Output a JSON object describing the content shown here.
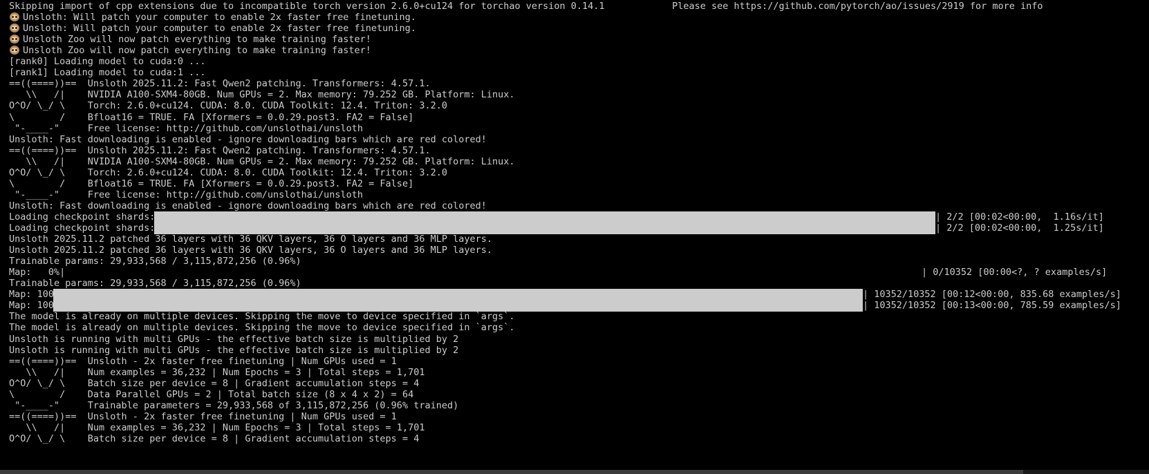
{
  "terminal": {
    "lines": [
      {
        "type": "text",
        "text": "Skipping import of cpp extensions due to incompatible torch version 2.6.0+cu124 for torchao version 0.14.1            Please see https://github.com/pytorch/ao/issues/2919 for more info"
      },
      {
        "type": "sloth",
        "text": "Unsloth: Will patch your computer to enable 2x faster free finetuning."
      },
      {
        "type": "sloth",
        "text": "Unsloth: Will patch your computer to enable 2x faster free finetuning."
      },
      {
        "type": "sloth",
        "text": "Unsloth Zoo will now patch everything to make training faster!"
      },
      {
        "type": "sloth",
        "text": "Unsloth Zoo will now patch everything to make training faster!"
      },
      {
        "type": "text",
        "text": "[rank0] Loading model to cuda:0 ..."
      },
      {
        "type": "text",
        "text": "[rank1] Loading model to cuda:1 ..."
      },
      {
        "type": "text",
        "text": "==((====))==  Unsloth 2025.11.2: Fast Qwen2 patching. Transformers: 4.57.1."
      },
      {
        "type": "text",
        "text": "   \\\\   /|    NVIDIA A100-SXM4-80GB. Num GPUs = 2. Max memory: 79.252 GB. Platform: Linux."
      },
      {
        "type": "text",
        "text": "O^O/ \\_/ \\    Torch: 2.6.0+cu124. CUDA: 8.0. CUDA Toolkit: 12.4. Triton: 3.2.0"
      },
      {
        "type": "text",
        "text": "\\        /    Bfloat16 = TRUE. FA [Xformers = 0.0.29.post3. FA2 = False]"
      },
      {
        "type": "text",
        "text": " \"-____-\"     Free license: http://github.com/unslothai/unsloth"
      },
      {
        "type": "text",
        "text": "Unsloth: Fast downloading is enabled - ignore downloading bars which are red colored!"
      },
      {
        "type": "text",
        "text": "==((====))==  Unsloth 2025.11.2: Fast Qwen2 patching. Transformers: 4.57.1."
      },
      {
        "type": "text",
        "text": "   \\\\   /|    NVIDIA A100-SXM4-80GB. Num GPUs = 2. Max memory: 79.252 GB. Platform: Linux."
      },
      {
        "type": "text",
        "text": "O^O/ \\_/ \\    Torch: 2.6.0+cu124. CUDA: 8.0. CUDA Toolkit: 12.4. Triton: 3.2.0"
      },
      {
        "type": "text",
        "text": "\\        /    Bfloat16 = TRUE. FA [Xformers = 0.0.29.post3. FA2 = False]"
      },
      {
        "type": "text",
        "text": " \"-____-\"     Free license: http://github.com/unslothai/unsloth"
      },
      {
        "type": "text",
        "text": "Unsloth: Fast downloading is enabled - ignore downloading bars which are red colored!"
      },
      {
        "type": "progress",
        "label": "Loading checkpoint shards: 100%|",
        "progress": 1.0,
        "suffix": "| 2/2 [00:02<00:00,  1.16s/it]",
        "bar": "shards"
      },
      {
        "type": "progress",
        "label": "Loading checkpoint shards: 100%|",
        "progress": 1.0,
        "suffix": "| 2/2 [00:02<00:00,  1.25s/it]",
        "bar": "shards"
      },
      {
        "type": "text",
        "text": "Unsloth 2025.11.2 patched 36 layers with 36 QKV layers, 36 O layers and 36 MLP layers."
      },
      {
        "type": "text",
        "text": "Unsloth 2025.11.2 patched 36 layers with 36 QKV layers, 36 O layers and 36 MLP layers."
      },
      {
        "type": "text",
        "text": "Trainable params: 29,933,568 / 3,115,872,256 (0.96%)"
      },
      {
        "type": "progress",
        "label": "Map:   0%|",
        "progress": 0.0,
        "suffix": "| 0/10352 [00:00<?, ? examples/s]",
        "bar": "map0"
      },
      {
        "type": "text",
        "text": "Trainable params: 29,933,568 / 3,115,872,256 (0.96%)"
      },
      {
        "type": "progress",
        "label": "Map: 100%|",
        "progress": 1.0,
        "suffix": "| 10352/10352 [00:12<00:00, 835.68 examples/s]",
        "bar": "map"
      },
      {
        "type": "progress",
        "label": "Map: 100%|",
        "progress": 1.0,
        "suffix": "| 10352/10352 [00:13<00:00, 785.59 examples/s]",
        "bar": "map"
      },
      {
        "type": "text",
        "text": "The model is already on multiple devices. Skipping the move to device specified in `args`."
      },
      {
        "type": "text",
        "text": "The model is already on multiple devices. Skipping the move to device specified in `args`."
      },
      {
        "type": "text",
        "text": "Unsloth is running with multi GPUs - the effective batch size is multiplied by 2"
      },
      {
        "type": "text",
        "text": "Unsloth is running with multi GPUs - the effective batch size is multiplied by 2"
      },
      {
        "type": "text",
        "text": "==((====))==  Unsloth - 2x faster free finetuning | Num GPUs used = 1"
      },
      {
        "type": "text",
        "text": "   \\\\   /|    Num examples = 36,232 | Num Epochs = 3 | Total steps = 1,701"
      },
      {
        "type": "text",
        "text": "O^O/ \\_/ \\    Batch size per device = 8 | Gradient accumulation steps = 4"
      },
      {
        "type": "text",
        "text": "\\        /    Data Parallel GPUs = 2 | Total batch size (8 x 4 x 2) = 64"
      },
      {
        "type": "text",
        "text": " \"-____-\"     Trainable parameters = 29,933,568 of 3,115,872,256 (0.96% trained)"
      },
      {
        "type": "text",
        "text": "==((====))==  Unsloth - 2x faster free finetuning | Num GPUs used = 1"
      },
      {
        "type": "text",
        "text": "   \\\\   /|    Num examples = 36,232 | Num Epochs = 3 | Total steps = 1,701"
      },
      {
        "type": "text",
        "text": "O^O/ \\_/ \\    Batch size per device = 8 | Gradient accumulation steps = 4"
      }
    ]
  },
  "icons": {
    "sloth": "sloth-emoji-icon"
  },
  "colors": {
    "background": "#000000",
    "text": "#cccccc",
    "progress_fill": "#cccccc"
  }
}
